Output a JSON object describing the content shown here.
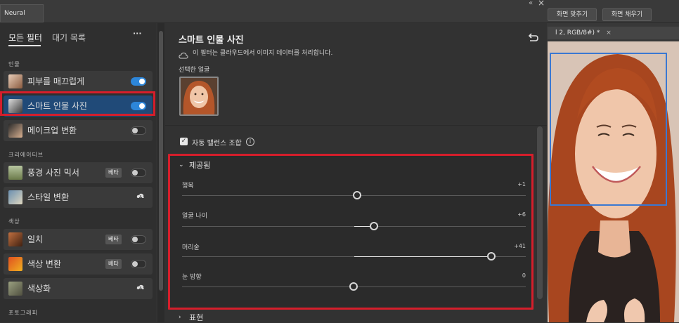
{
  "app": {
    "panel_tab": "Neural Filters",
    "collapse_glyph": "«",
    "close_glyph": "×",
    "toolbar_buttons": [
      "화면 맞추기",
      "화면 채우기"
    ],
    "document_tab": "l 2, RGB/8#) *",
    "document_tab_close": "×"
  },
  "left_panel": {
    "tabs": [
      {
        "label": "모든 필터",
        "active": true
      },
      {
        "label": "대기 목록",
        "active": false
      }
    ],
    "menu_glyph": "···",
    "sections": [
      {
        "title": "인물",
        "items": [
          {
            "label": "피부를 매끄럽게",
            "control": "toggle",
            "on": true
          },
          {
            "label": "스마트 인물 사진",
            "control": "toggle",
            "on": true,
            "selected": true
          },
          {
            "label": "메이크업 변환",
            "control": "toggle",
            "on": false
          }
        ]
      },
      {
        "title": "크리에이티브",
        "items": [
          {
            "label": "풍경 사진 믹서",
            "badge": "베타",
            "control": "toggle",
            "on": false
          },
          {
            "label": "스타일 변환",
            "control": "cloud"
          }
        ]
      },
      {
        "title": "색상",
        "items": [
          {
            "label": "일치",
            "badge": "베타",
            "control": "toggle",
            "on": false
          },
          {
            "label": "색상 변환",
            "badge": "베타",
            "control": "toggle",
            "on": false
          },
          {
            "label": "색상화",
            "control": "cloud"
          }
        ]
      },
      {
        "title": "포토그래피",
        "items": []
      }
    ]
  },
  "main": {
    "title": "스마트 인물 사진",
    "cloud_note": "이 필터는 클라우드에서 이미지 데이터를 처리합니다.",
    "selected_face_label": "선택한 얼굴",
    "auto_balance": {
      "label": "자동 밸런스 조합",
      "checked": true,
      "check_glyph": "✓",
      "info_glyph": "i"
    },
    "featured_section": {
      "label": "제공됨",
      "chevron": "⌄",
      "sliders": [
        {
          "label": "행복",
          "value_text": "+1",
          "value": 1
        },
        {
          "label": "얼굴 나이",
          "value_text": "+6",
          "value": 6
        },
        {
          "label": "머리숱",
          "value_text": "+41",
          "value": 41
        },
        {
          "label": "눈 방향",
          "value_text": "0",
          "value": 0
        }
      ]
    },
    "next_section": {
      "label": "표현",
      "chevron": "›"
    }
  },
  "colors": {
    "accent": "#2d86d9",
    "selected_bg": "#204a78",
    "highlight_red": "#d51e2b",
    "face_box": "#3a78d2"
  }
}
